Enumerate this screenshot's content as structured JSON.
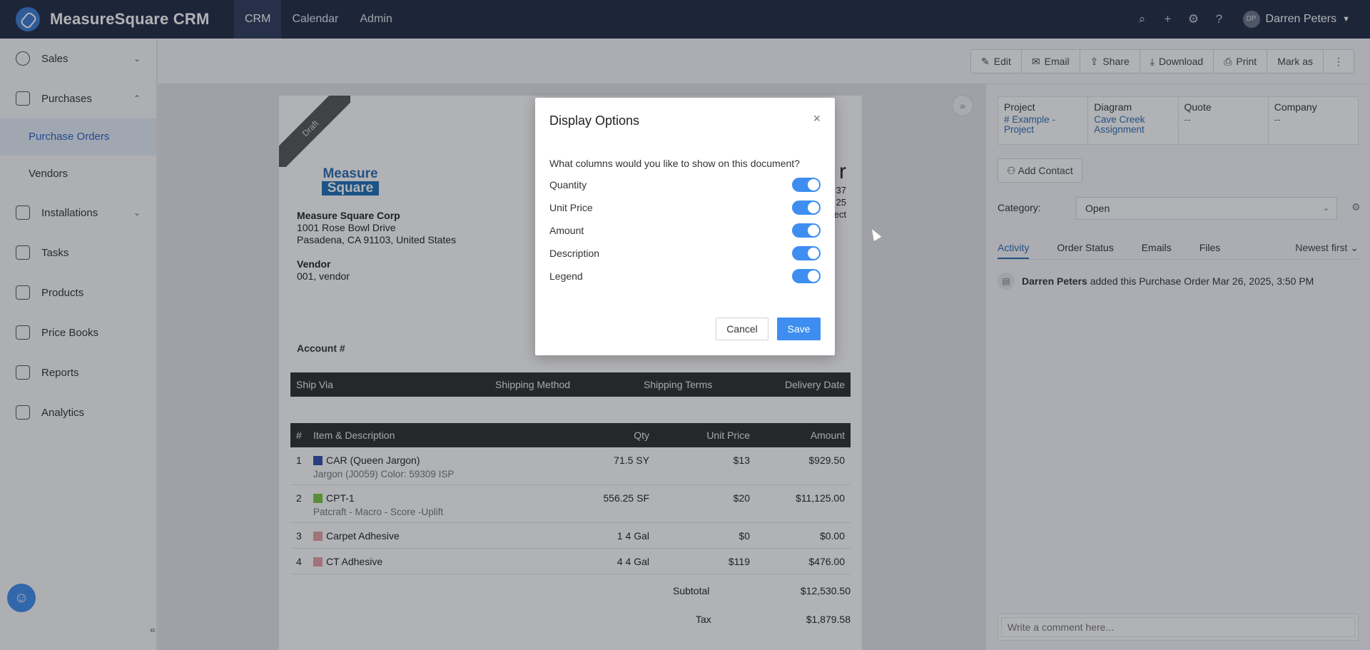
{
  "app": {
    "title": "MeasureSquare CRM"
  },
  "nav": {
    "tabs": [
      "CRM",
      "Calendar",
      "Admin"
    ]
  },
  "user": {
    "initials": "DP",
    "name": "Darren Peters"
  },
  "sidebar": {
    "items": [
      "Sales",
      "Purchases",
      "Installations",
      "Tasks",
      "Products",
      "Price Books",
      "Reports",
      "Analytics"
    ],
    "sub": [
      "Purchase Orders",
      "Vendors"
    ]
  },
  "toolbar": {
    "edit": "Edit",
    "email": "Email",
    "share": "Share",
    "download": "Download",
    "print": "Print",
    "mark": "Mark as",
    "more": "⋮"
  },
  "doc": {
    "ribbon": "Draft",
    "logo1": "Measure",
    "logo2": "Square",
    "company": "Measure Square Corp",
    "addr1": "1001 Rose Bowl Drive",
    "addr2": "Pasadena, CA 91103, United States",
    "vendor_label": "Vendor",
    "vendor": "001, vendor",
    "rhs_big": "r",
    "rhs1": "37",
    "rhs2": "25",
    "rhs3": "ect",
    "account": "Account #",
    "ship_headers": [
      "Ship Via",
      "Shipping Method",
      "Shipping Terms",
      "Delivery Date"
    ],
    "item_headers": [
      "#",
      "Item & Description",
      "Qty",
      "Unit Price",
      "Amount"
    ],
    "items": [
      {
        "n": "1",
        "name": "CAR (Queen Jargon)",
        "desc": "Jargon (J0059) Color: 59309 ISP",
        "qty": "71.5 SY",
        "unit": "$13",
        "amount": "$929.50",
        "color": "#2f4fb0"
      },
      {
        "n": "2",
        "name": "CPT-1",
        "desc": "Patcraft - Macro - Score -Uplift",
        "qty": "556.25 SF",
        "unit": "$20",
        "amount": "$11,125.00",
        "color": "#7ac943"
      },
      {
        "n": "3",
        "name": "Carpet Adhesive",
        "desc": "",
        "qty": "1 4 Gal",
        "unit": "$0",
        "amount": "$0.00",
        "color": "#e8a0a8"
      },
      {
        "n": "4",
        "name": "CT Adhesive",
        "desc": "",
        "qty": "4 4 Gal",
        "unit": "$119",
        "amount": "$476.00",
        "color": "#e8a0a8"
      }
    ],
    "subtotal_label": "Subtotal",
    "subtotal": "$12,530.50",
    "tax_label": "Tax",
    "tax": "$1,879.58"
  },
  "panel": {
    "project_label": "Project",
    "project": "# Example - Project",
    "diagram_label": "Diagram",
    "diagram": "Cave Creek Assignment",
    "quote_label": "Quote",
    "quote": "--",
    "company_label": "Company",
    "company": "--",
    "add_contact": "Add Contact",
    "category_label": "Category:",
    "category": "Open",
    "tabs": [
      "Activity",
      "Order Status",
      "Emails",
      "Files"
    ],
    "sort": "Newest first",
    "activity_user": "Darren Peters",
    "activity_text": "added this Purchase Order Mar 26, 2025, 3:50 PM",
    "comment_placeholder": "Write a comment here..."
  },
  "modal": {
    "title": "Display Options",
    "question": "What columns would you like to show on this document?",
    "options": [
      "Quantity",
      "Unit Price",
      "Amount",
      "Description",
      "Legend"
    ],
    "cancel": "Cancel",
    "save": "Save"
  },
  "colors": {
    "topbar": "#1f2a44",
    "accent": "#3d8ef0",
    "link": "#2b6cb3"
  }
}
